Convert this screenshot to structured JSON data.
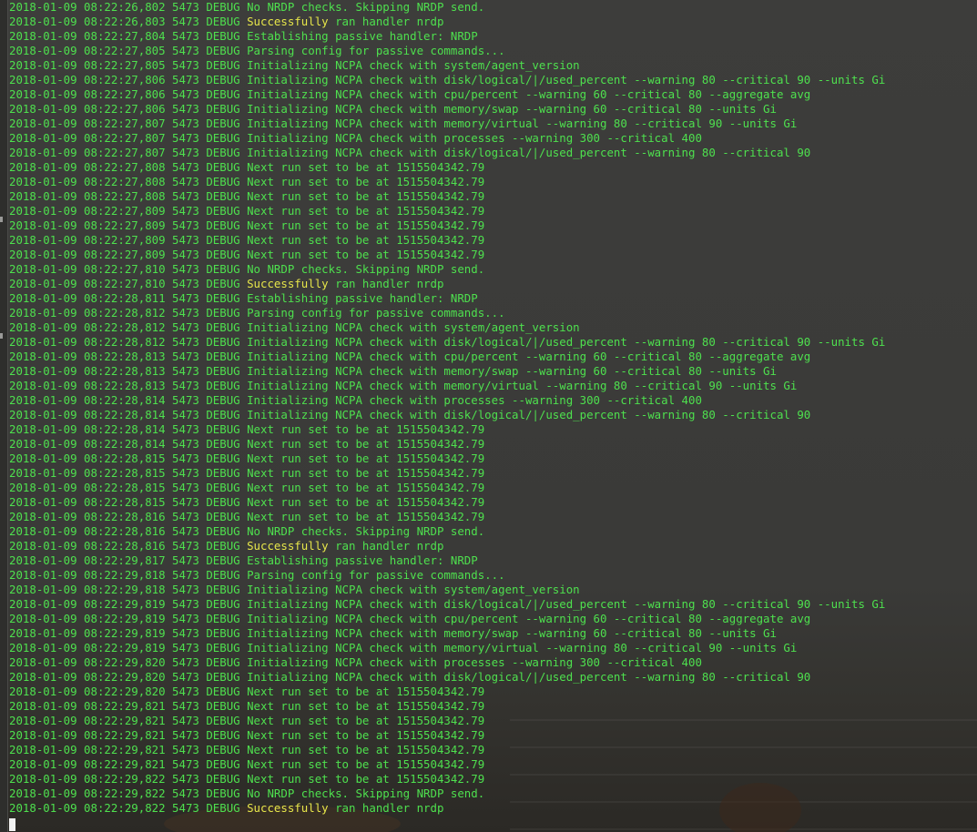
{
  "colors": {
    "log_text": "#4ee04e",
    "highlight_text": "#e6e64a",
    "terminal_background": "#3b3b39",
    "cursor": "#f2f2f2"
  },
  "terminal": {
    "lines": [
      {
        "text": "2018-01-09 08:22:26,802 5473 DEBUG No NRDP checks. Skipping NRDP send."
      },
      {
        "text": "2018-01-09 08:22:26,803 5473 DEBUG ",
        "highlight": "Successfully",
        "after": " ran handler nrdp"
      },
      {
        "text": "2018-01-09 08:22:27,804 5473 DEBUG Establishing passive handler: NRDP"
      },
      {
        "text": "2018-01-09 08:22:27,805 5473 DEBUG Parsing config for passive commands..."
      },
      {
        "text": "2018-01-09 08:22:27,805 5473 DEBUG Initializing NCPA check with system/agent_version"
      },
      {
        "text": "2018-01-09 08:22:27,806 5473 DEBUG Initializing NCPA check with disk/logical/|/used_percent --warning 80 --critical 90 --units Gi"
      },
      {
        "text": "2018-01-09 08:22:27,806 5473 DEBUG Initializing NCPA check with cpu/percent --warning 60 --critical 80 --aggregate avg"
      },
      {
        "text": "2018-01-09 08:22:27,806 5473 DEBUG Initializing NCPA check with memory/swap --warning 60 --critical 80 --units Gi"
      },
      {
        "text": "2018-01-09 08:22:27,807 5473 DEBUG Initializing NCPA check with memory/virtual --warning 80 --critical 90 --units Gi"
      },
      {
        "text": "2018-01-09 08:22:27,807 5473 DEBUG Initializing NCPA check with processes --warning 300 --critical 400"
      },
      {
        "text": "2018-01-09 08:22:27,807 5473 DEBUG Initializing NCPA check with disk/logical/|/used_percent --warning 80 --critical 90"
      },
      {
        "text": "2018-01-09 08:22:27,808 5473 DEBUG Next run set to be at 1515504342.79"
      },
      {
        "text": "2018-01-09 08:22:27,808 5473 DEBUG Next run set to be at 1515504342.79"
      },
      {
        "text": "2018-01-09 08:22:27,808 5473 DEBUG Next run set to be at 1515504342.79"
      },
      {
        "text": "2018-01-09 08:22:27,809 5473 DEBUG Next run set to be at 1515504342.79"
      },
      {
        "text": "2018-01-09 08:22:27,809 5473 DEBUG Next run set to be at 1515504342.79"
      },
      {
        "text": "2018-01-09 08:22:27,809 5473 DEBUG Next run set to be at 1515504342.79"
      },
      {
        "text": "2018-01-09 08:22:27,809 5473 DEBUG Next run set to be at 1515504342.79"
      },
      {
        "text": "2018-01-09 08:22:27,810 5473 DEBUG No NRDP checks. Skipping NRDP send."
      },
      {
        "text": "2018-01-09 08:22:27,810 5473 DEBUG ",
        "highlight": "Successfully",
        "after": " ran handler nrdp"
      },
      {
        "text": "2018-01-09 08:22:28,811 5473 DEBUG Establishing passive handler: NRDP"
      },
      {
        "text": "2018-01-09 08:22:28,812 5473 DEBUG Parsing config for passive commands..."
      },
      {
        "text": "2018-01-09 08:22:28,812 5473 DEBUG Initializing NCPA check with system/agent_version"
      },
      {
        "text": "2018-01-09 08:22:28,812 5473 DEBUG Initializing NCPA check with disk/logical/|/used_percent --warning 80 --critical 90 --units Gi"
      },
      {
        "text": "2018-01-09 08:22:28,813 5473 DEBUG Initializing NCPA check with cpu/percent --warning 60 --critical 80 --aggregate avg"
      },
      {
        "text": "2018-01-09 08:22:28,813 5473 DEBUG Initializing NCPA check with memory/swap --warning 60 --critical 80 --units Gi"
      },
      {
        "text": "2018-01-09 08:22:28,813 5473 DEBUG Initializing NCPA check with memory/virtual --warning 80 --critical 90 --units Gi"
      },
      {
        "text": "2018-01-09 08:22:28,814 5473 DEBUG Initializing NCPA check with processes --warning 300 --critical 400"
      },
      {
        "text": "2018-01-09 08:22:28,814 5473 DEBUG Initializing NCPA check with disk/logical/|/used_percent --warning 80 --critical 90"
      },
      {
        "text": "2018-01-09 08:22:28,814 5473 DEBUG Next run set to be at 1515504342.79"
      },
      {
        "text": "2018-01-09 08:22:28,814 5473 DEBUG Next run set to be at 1515504342.79"
      },
      {
        "text": "2018-01-09 08:22:28,815 5473 DEBUG Next run set to be at 1515504342.79"
      },
      {
        "text": "2018-01-09 08:22:28,815 5473 DEBUG Next run set to be at 1515504342.79"
      },
      {
        "text": "2018-01-09 08:22:28,815 5473 DEBUG Next run set to be at 1515504342.79"
      },
      {
        "text": "2018-01-09 08:22:28,815 5473 DEBUG Next run set to be at 1515504342.79"
      },
      {
        "text": "2018-01-09 08:22:28,816 5473 DEBUG Next run set to be at 1515504342.79"
      },
      {
        "text": "2018-01-09 08:22:28,816 5473 DEBUG No NRDP checks. Skipping NRDP send."
      },
      {
        "text": "2018-01-09 08:22:28,816 5473 DEBUG ",
        "highlight": "Successfully",
        "after": " ran handler nrdp"
      },
      {
        "text": "2018-01-09 08:22:29,817 5473 DEBUG Establishing passive handler: NRDP"
      },
      {
        "text": "2018-01-09 08:22:29,818 5473 DEBUG Parsing config for passive commands..."
      },
      {
        "text": "2018-01-09 08:22:29,818 5473 DEBUG Initializing NCPA check with system/agent_version"
      },
      {
        "text": "2018-01-09 08:22:29,819 5473 DEBUG Initializing NCPA check with disk/logical/|/used_percent --warning 80 --critical 90 --units Gi"
      },
      {
        "text": "2018-01-09 08:22:29,819 5473 DEBUG Initializing NCPA check with cpu/percent --warning 60 --critical 80 --aggregate avg"
      },
      {
        "text": "2018-01-09 08:22:29,819 5473 DEBUG Initializing NCPA check with memory/swap --warning 60 --critical 80 --units Gi"
      },
      {
        "text": "2018-01-09 08:22:29,819 5473 DEBUG Initializing NCPA check with memory/virtual --warning 80 --critical 90 --units Gi"
      },
      {
        "text": "2018-01-09 08:22:29,820 5473 DEBUG Initializing NCPA check with processes --warning 300 --critical 400"
      },
      {
        "text": "2018-01-09 08:22:29,820 5473 DEBUG Initializing NCPA check with disk/logical/|/used_percent --warning 80 --critical 90"
      },
      {
        "text": "2018-01-09 08:22:29,820 5473 DEBUG Next run set to be at 1515504342.79"
      },
      {
        "text": "2018-01-09 08:22:29,821 5473 DEBUG Next run set to be at 1515504342.79"
      },
      {
        "text": "2018-01-09 08:22:29,821 5473 DEBUG Next run set to be at 1515504342.79"
      },
      {
        "text": "2018-01-09 08:22:29,821 5473 DEBUG Next run set to be at 1515504342.79"
      },
      {
        "text": "2018-01-09 08:22:29,821 5473 DEBUG Next run set to be at 1515504342.79"
      },
      {
        "text": "2018-01-09 08:22:29,821 5473 DEBUG Next run set to be at 1515504342.79"
      },
      {
        "text": "2018-01-09 08:22:29,822 5473 DEBUG Next run set to be at 1515504342.79"
      },
      {
        "text": "2018-01-09 08:22:29,822 5473 DEBUG No NRDP checks. Skipping NRDP send."
      },
      {
        "text": "2018-01-09 08:22:29,822 5473 DEBUG ",
        "highlight": "Successfully",
        "after": " ran handler nrdp"
      }
    ]
  }
}
